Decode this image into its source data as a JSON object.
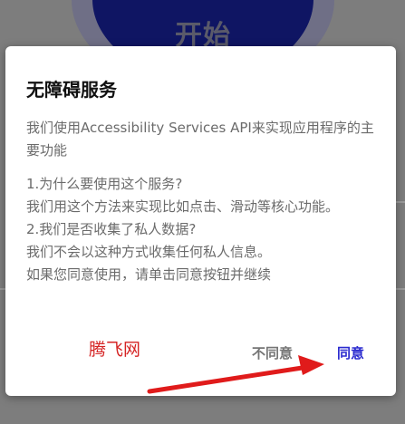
{
  "background": {
    "start_label": "开始"
  },
  "dialog": {
    "title": "无障碍服务",
    "intro": "我们使用Accessibility Services API来实现应用程序的主要功能",
    "lines": [
      "1.为什么要使用这个服务?",
      "我们用这个方法来实现比如点击、滑动等核心功能。",
      "2.我们是否收集了私人数据?",
      "我们不会以这种方式收集任何私人信息。",
      "如果您同意使用，请单击同意按钮并继续"
    ],
    "watermark": "腾飞网",
    "disagree_label": "不同意",
    "agree_label": "同意"
  },
  "colors": {
    "accent": "#2b2bcf",
    "watermark": "#d52424",
    "arrow": "#e01b1b"
  }
}
